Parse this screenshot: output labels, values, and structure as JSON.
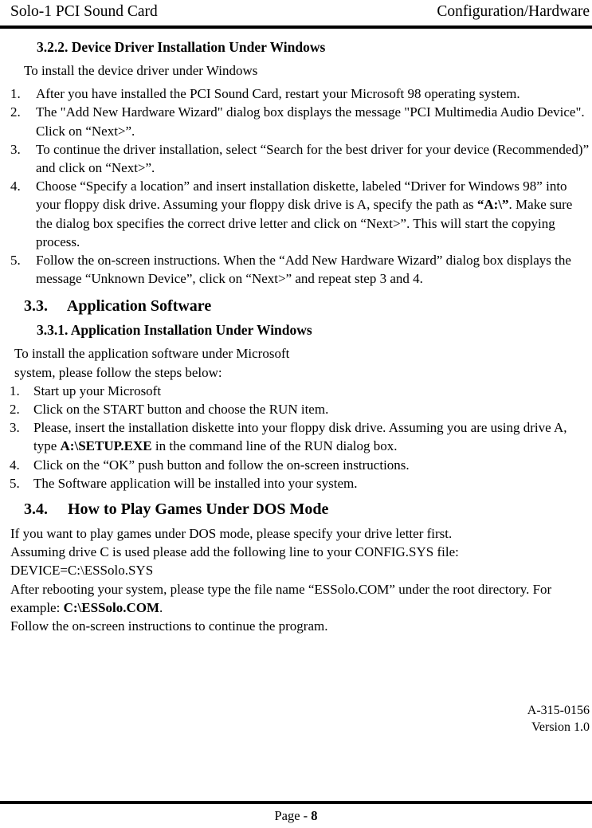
{
  "header": {
    "left_title": "Solo-1 PCI Sound Card",
    "right_title": "Configuration/Hardware"
  },
  "sections": {
    "s322": {
      "number": "3.2.2.",
      "title": "Device Driver Installation Under Windows",
      "heading_full": "3.2.2.   Device Driver Installation Under Windows",
      "intro": "To install the device driver under Windows",
      "steps": [
        {
          "num": "1.",
          "text": "After you have installed the PCI Sound Card, restart your Microsoft 98 operating system."
        },
        {
          "num": "2.",
          "text": "The \"Add New Hardware Wizard\" dialog box displays the message \"PCI Multimedia Audio Device\". Click on “Next>”."
        },
        {
          "num": "3.",
          "text": "To continue the driver installation, select “Search for the best driver for your device (Recommended)” and click on “Next>”."
        },
        {
          "num": "4.",
          "text_before": "Choose “Specify a location” and insert installation diskette, labeled “Driver for Windows 98” into your floppy disk drive. Assuming your floppy disk drive is A, specify the path as ",
          "bold": "“A:\\”",
          "text_after": ". Make sure the dialog box specifies the correct drive letter and click on “Next>”. This will start the copying process."
        },
        {
          "num": "5.",
          "text": "Follow the on-screen instructions. When the “Add New Hardware Wizard” dialog box displays the message “Unknown Device”, click on “Next>” and repeat step 3 and 4."
        }
      ]
    },
    "s33": {
      "number": "3.3.",
      "title": "Application Software",
      "heading_full": "3.3.  Application Software"
    },
    "s331": {
      "number": "3.3.1.",
      "title": "Application Installation Under Windows",
      "heading_full": "3.3.1.   Application Installation Under Windows",
      "intro_line1": "To install the application software under Microsoft",
      "intro_line2": "system, please follow the steps below:",
      "steps": [
        {
          "num": "1.",
          "text": "Start up your Microsoft"
        },
        {
          "num": "2.",
          "text": "Click on the START button and choose the RUN item."
        },
        {
          "num": "3.",
          "text_before": "Please, insert the installation diskette into your floppy disk drive. Assuming you are using drive A, type ",
          "bold": "A:\\SETUP.EXE",
          "text_after": " in the command line of the RUN dialog box."
        },
        {
          "num": "4.",
          "text": "Click on the “OK” push button and follow the on-screen instructions."
        },
        {
          "num": "5.",
          "text": "The Software application will be installed into your system."
        }
      ]
    },
    "s34": {
      "number": "3.4.",
      "title": "How to Play Games Under DOS Mode",
      "heading_full": "3.4.  How to Play Games Under DOS Mode",
      "line1": "If you want to play games under DOS mode, please specify your drive letter first.",
      "line2": "Assuming drive C is used please add the following line to your CONFIG.SYS file:",
      "line3": "DEVICE=C:\\ESSolo.SYS",
      "line4_before": "After rebooting your system, please type the file name “ESSolo.COM” under the root directory. For example: ",
      "line4_bold": "C:\\ESSolo.COM",
      "line4_after": ".",
      "line5": "Follow the on-screen instructions to continue the program."
    }
  },
  "footer": {
    "doc_id": "A-315-0156",
    "version": "Version 1.0",
    "page_label": "Page - ",
    "page_number": "8"
  }
}
